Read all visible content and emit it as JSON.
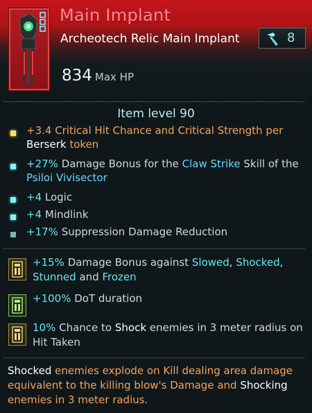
{
  "item": {
    "name": "Main Implant",
    "type_line": "Archeotech Relic Main Implant",
    "power_value": "8",
    "hp_value": "834",
    "hp_label": "Max HP",
    "item_level": "Item level 90",
    "icon": "implant-relic-icon",
    "power_icon": "hammer-icon"
  },
  "mods": [
    {
      "dot": "yellow",
      "parts": [
        {
          "t": "+3.4 ",
          "c": "orange"
        },
        {
          "t": "Critical Hit Chance and Critical Strength per ",
          "c": "orange"
        },
        {
          "t": "Berserk",
          "c": "white"
        },
        {
          "t": " token",
          "c": "orange"
        }
      ]
    },
    {
      "dot": "cyan",
      "parts": [
        {
          "t": "+27%",
          "c": "cyan"
        },
        {
          "t": " Damage Bonus for the ",
          "c": "grey"
        },
        {
          "t": "Claw Strike",
          "c": "blue"
        },
        {
          "t": " Skill of the ",
          "c": "grey"
        },
        {
          "t": "Psiloi Vivisector",
          "c": "blue"
        }
      ]
    },
    {
      "dot": "cyan",
      "parts": [
        {
          "t": "+4",
          "c": "cyan"
        },
        {
          "t": " Logic",
          "c": "grey"
        }
      ]
    },
    {
      "dot": "cyan",
      "parts": [
        {
          "t": "+4",
          "c": "cyan"
        },
        {
          "t": " Mindlink",
          "c": "grey"
        }
      ]
    },
    {
      "dot": "teal",
      "parts": [
        {
          "t": "+17%",
          "c": "cyan"
        },
        {
          "t": " Suppression Damage Reduction",
          "c": "grey"
        }
      ]
    }
  ],
  "implant_mods": [
    {
      "badge": "gold",
      "parts": [
        {
          "t": "+15%",
          "c": "cyan"
        },
        {
          "t": " Damage Bonus against ",
          "c": "grey"
        },
        {
          "t": "Slowed",
          "c": "cyan"
        },
        {
          "t": ", ",
          "c": "grey"
        },
        {
          "t": "Shocked",
          "c": "cyan"
        },
        {
          "t": ", ",
          "c": "grey"
        },
        {
          "t": "Stunned",
          "c": "cyan"
        },
        {
          "t": " and ",
          "c": "grey"
        },
        {
          "t": "Frozen",
          "c": "cyan"
        }
      ]
    },
    {
      "badge": "green",
      "parts": [
        {
          "t": "+100%",
          "c": "cyan"
        },
        {
          "t": " DoT duration",
          "c": "grey"
        }
      ]
    },
    {
      "badge": "gold",
      "parts": [
        {
          "t": "10%",
          "c": "cyan"
        },
        {
          "t": " Chance to ",
          "c": "grey"
        },
        {
          "t": "Shock",
          "c": "white"
        },
        {
          "t": " enemies in 3 meter radius on Hit Taken",
          "c": "grey"
        }
      ]
    }
  ],
  "unique_effect": {
    "parts": [
      {
        "t": "Shocked",
        "c": "white"
      },
      {
        "t": " enemies explode on Kill dealing area damage equivalent to the killing blow's Damage and ",
        "c": "orange"
      },
      {
        "t": "Shocking",
        "c": "white"
      },
      {
        "t": " enemies in 3 meter radius.",
        "c": "orange"
      }
    ]
  },
  "colors": {
    "header_red": "#c4161c",
    "title": "#ff8a8e",
    "affix_cyan": "#63e6ee",
    "affix_orange": "#f7a35c"
  }
}
